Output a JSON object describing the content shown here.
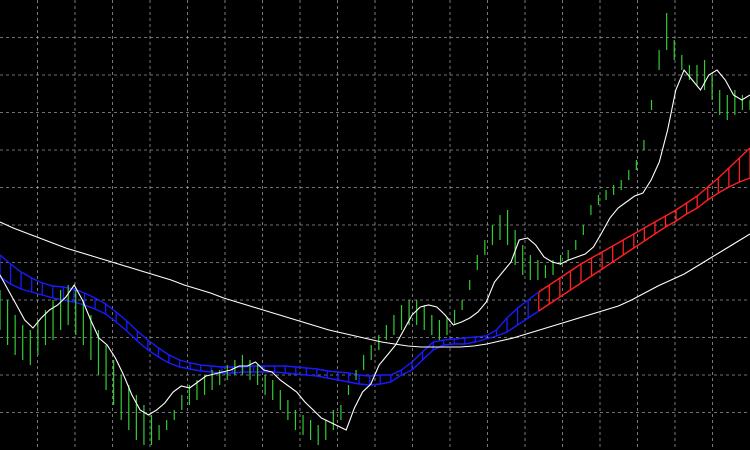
{
  "chart_header": "",
  "colors": {
    "background": "#000000",
    "grid": "#c8c8c8",
    "bars": "#33cc33",
    "price_line": "#ffffff",
    "slow_ma": "#ffffff",
    "band_down": "#1a1aff",
    "band_up": "#ff2020"
  },
  "chart_data": {
    "type": "line",
    "title": "",
    "xlabel": "",
    "ylabel": "",
    "grid": true,
    "legend": "none",
    "ylim": [
      0,
      450
    ],
    "x_count": 100,
    "series": [
      {
        "role": "price_bars",
        "high": [
          290,
          300,
          315,
          325,
          330,
          320,
          310,
          300,
          290,
          285,
          290,
          300,
          315,
          330,
          345,
          360,
          375,
          385,
          395,
          405,
          415,
          425,
          420,
          410,
          395,
          385,
          380,
          375,
          370,
          370,
          365,
          360,
          355,
          360,
          365,
          375,
          380,
          390,
          400,
          410,
          415,
          420,
          425,
          420,
          410,
          405,
          385,
          370,
          355,
          345,
          335,
          325,
          315,
          305,
          300,
          300,
          305,
          315,
          320,
          318,
          310,
          300,
          280,
          255,
          240,
          225,
          215,
          210,
          230,
          245,
          255,
          260,
          265,
          260,
          255,
          250,
          240,
          225,
          205,
          195,
          190,
          185,
          180,
          170,
          160,
          140,
          100,
          50,
          13,
          40,
          55,
          65,
          65,
          60,
          75,
          90,
          95,
          90,
          95,
          100
        ],
        "low": [
          330,
          345,
          355,
          360,
          365,
          355,
          345,
          340,
          330,
          325,
          335,
          345,
          360,
          375,
          390,
          405,
          420,
          430,
          440,
          445,
          445,
          440,
          430,
          420,
          410,
          405,
          400,
          395,
          390,
          385,
          380,
          375,
          375,
          380,
          385,
          395,
          400,
          410,
          420,
          430,
          435,
          440,
          445,
          440,
          430,
          420,
          395,
          380,
          370,
          360,
          350,
          340,
          335,
          330,
          325,
          325,
          330,
          335,
          340,
          335,
          325,
          310,
          290,
          270,
          255,
          245,
          240,
          245,
          265,
          275,
          280,
          280,
          278,
          275,
          265,
          260,
          250,
          235,
          215,
          205,
          200,
          195,
          190,
          180,
          170,
          150,
          110,
          70,
          50,
          60,
          70,
          80,
          85,
          90,
          100,
          115,
          120,
          115,
          110,
          110
        ]
      },
      {
        "role": "price_line",
        "values": [
          275,
          290,
          305,
          320,
          328,
          318,
          310,
          305,
          297,
          285,
          300,
          320,
          338,
          345,
          358,
          375,
          395,
          410,
          415,
          410,
          403,
          392,
          386,
          388,
          382,
          376,
          374,
          372,
          370,
          366,
          366,
          362,
          370,
          372,
          380,
          386,
          392,
          402,
          410,
          418,
          422,
          426,
          430,
          408,
          392,
          384,
          365,
          355,
          345,
          330,
          315,
          307,
          305,
          307,
          315,
          325,
          322,
          318,
          312,
          302,
          282,
          272,
          262,
          240,
          238,
          245,
          257,
          262,
          264,
          260,
          257,
          254,
          247,
          233,
          218,
          208,
          202,
          196,
          193,
          180,
          162,
          130,
          90,
          70,
          80,
          90,
          75,
          70,
          80,
          95,
          100,
          95
        ]
      },
      {
        "role": "band_upper",
        "values": [
          255,
          264,
          272,
          278,
          283,
          286,
          287,
          289,
          293,
          298,
          304,
          312,
          321,
          331,
          340,
          348,
          355,
          360,
          363,
          365,
          366,
          367,
          367,
          367,
          366,
          366,
          366,
          366,
          367,
          368,
          369,
          371,
          372,
          373,
          375,
          376,
          375,
          375,
          370,
          362,
          352,
          342,
          340,
          339,
          338,
          337,
          336,
          330,
          318,
          308,
          300,
          292,
          285,
          278,
          271,
          264,
          258,
          252,
          246,
          240,
          234,
          228,
          222,
          216,
          210,
          203,
          196,
          187,
          178,
          168,
          158,
          148
        ]
      },
      {
        "role": "band_lower",
        "values": [
          277,
          284,
          289,
          292,
          295,
          298,
          300,
          302,
          305,
          309,
          314,
          322,
          331,
          341,
          350,
          357,
          363,
          367,
          369,
          371,
          372,
          373,
          373,
          372,
          372,
          372,
          372,
          373,
          374,
          375,
          376,
          378,
          380,
          382,
          384,
          385,
          384,
          382,
          375,
          370,
          360,
          350,
          345,
          344,
          344,
          342,
          339,
          336,
          332,
          325,
          318,
          311,
          304,
          297,
          290,
          283,
          276,
          269,
          262,
          255,
          248,
          241,
          234,
          227,
          221,
          214,
          208,
          200,
          193,
          187,
          182,
          178
        ]
      },
      {
        "role": "slow_ma",
        "values": [
          222,
          228,
          233,
          238,
          243,
          248,
          252,
          256,
          260,
          264,
          268,
          272,
          276,
          280,
          285,
          289,
          293,
          298,
          302,
          306,
          310,
          314,
          318,
          322,
          326,
          330,
          333,
          336,
          339,
          342,
          344,
          346,
          347,
          347,
          347,
          347,
          346,
          344,
          341,
          338,
          334,
          330,
          326,
          322,
          318,
          314,
          310,
          306,
          300,
          293,
          286,
          280,
          274,
          266,
          258,
          250,
          242,
          234
        ]
      }
    ]
  }
}
